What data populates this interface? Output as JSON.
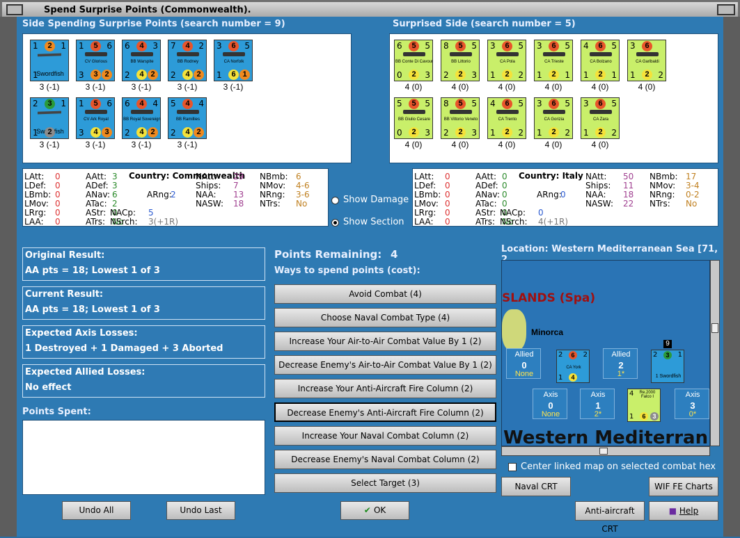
{
  "window": {
    "title": "Spend Surprise Points (Commonwealth)."
  },
  "left_panel": {
    "heading": "Side Spending Surprise Points (search number = 9)",
    "units": [
      {
        "tl": "1",
        "tm": "2",
        "tr": "1",
        "bl": "1",
        "bm": "",
        "br": "",
        "name": "Swordfish",
        "caption": "3 (-1)",
        "type": "air",
        "c1": "orange",
        "c2": "gray"
      },
      {
        "tl": "1",
        "tm": "5",
        "tr": "6",
        "bl": "3",
        "bm": "3",
        "br": "2",
        "name": "CV Glorious",
        "caption": "3 (-1)",
        "type": "ship",
        "c1": "red",
        "c2": "orange"
      },
      {
        "tl": "6",
        "tm": "4",
        "tr": "3",
        "bl": "2",
        "bm": "4",
        "br": "2",
        "name": "BB Warspite",
        "caption": "3 (-1)",
        "type": "ship",
        "c1": "red",
        "c2": "yellow"
      },
      {
        "tl": "7",
        "tm": "4",
        "tr": "2",
        "bl": "2",
        "bm": "4",
        "br": "2",
        "name": "BB Rodney",
        "caption": "3 (-1)",
        "type": "ship",
        "c1": "red",
        "c2": "yellow"
      },
      {
        "tl": "3",
        "tm": "6",
        "tr": "5",
        "bl": "1",
        "bm": "6",
        "br": "1",
        "name": "CA Norfolk",
        "caption": "3 (-1)",
        "type": "ship",
        "c1": "red",
        "c2": "yellow"
      },
      {
        "tl": "2",
        "tm": "3",
        "tr": "1",
        "bl": "1",
        "bm": "2",
        "br": "",
        "name": "Swordfish",
        "caption": "3 (-1)",
        "type": "air",
        "c1": "green",
        "c2": "gray"
      },
      {
        "tl": "1",
        "tm": "5",
        "tr": "6",
        "bl": "3",
        "bm": "4",
        "br": "3",
        "name": "CV Ark Royal",
        "caption": "3 (-1)",
        "type": "ship",
        "c1": "red",
        "c2": "yellow"
      },
      {
        "tl": "6",
        "tm": "4",
        "tr": "4",
        "bl": "2",
        "bm": "4",
        "br": "2",
        "name": "BB Royal Sovereign",
        "caption": "3 (-1)",
        "type": "ship",
        "c1": "red",
        "c2": "yellow"
      },
      {
        "tl": "5",
        "tm": "4",
        "tr": "4",
        "bl": "2",
        "bm": "4",
        "br": "2",
        "name": "BB Ramillies",
        "caption": "3 (-1)",
        "type": "ship",
        "c1": "red",
        "c2": "yellow"
      }
    ]
  },
  "right_panel": {
    "heading": "Surprised Side (search number = 5)",
    "units": [
      {
        "tl": "6",
        "tm": "5",
        "tr": "5",
        "bl": "0",
        "bm": "2",
        "br": "3",
        "name": "BB Conte Di Cavour",
        "caption": "4 (0)"
      },
      {
        "tl": "8",
        "tm": "5",
        "tr": "5",
        "bl": "2",
        "bm": "2",
        "br": "3",
        "name": "BB Littorio",
        "caption": "4 (0)"
      },
      {
        "tl": "3",
        "tm": "6",
        "tr": "5",
        "bl": "1",
        "bm": "2",
        "br": "2",
        "name": "CA Pola",
        "caption": "4 (0)"
      },
      {
        "tl": "3",
        "tm": "6",
        "tr": "5",
        "bl": "1",
        "bm": "2",
        "br": "1",
        "name": "CA Trieste",
        "caption": "4 (0)"
      },
      {
        "tl": "4",
        "tm": "6",
        "tr": "5",
        "bl": "1",
        "bm": "2",
        "br": "1",
        "name": "CA Bolzano",
        "caption": "4 (0)"
      },
      {
        "tl": "3",
        "tm": "6",
        "tr": "",
        "bl": "1",
        "bm": "2",
        "br": "2",
        "name": "CA Garibaldi",
        "caption": "4 (0)"
      },
      {
        "tl": "5",
        "tm": "5",
        "tr": "5",
        "bl": "0",
        "bm": "2",
        "br": "3",
        "name": "BB Giulio Cesare",
        "caption": "4 (0)"
      },
      {
        "tl": "8",
        "tm": "5",
        "tr": "5",
        "bl": "2",
        "bm": "2",
        "br": "3",
        "name": "BB Vittorio Veneto",
        "caption": "4 (0)"
      },
      {
        "tl": "4",
        "tm": "6",
        "tr": "5",
        "bl": "1",
        "bm": "2",
        "br": "2",
        "name": "CA Trento",
        "caption": "4 (0)"
      },
      {
        "tl": "3",
        "tm": "6",
        "tr": "5",
        "bl": "1",
        "bm": "2",
        "br": "2",
        "name": "CA Gorizia",
        "caption": "4 (0)"
      },
      {
        "tl": "3",
        "tm": "6",
        "tr": "5",
        "bl": "1",
        "bm": "2",
        "br": "2",
        "name": "CA Zara",
        "caption": "4 (0)"
      }
    ]
  },
  "stats_left": {
    "country": "Country: Commonwealth",
    "rows": [
      [
        "LAtt:",
        "0",
        "AAtt:",
        "3",
        "",
        "",
        "NAtt:",
        "29",
        "NBmb:",
        "6"
      ],
      [
        "LDef:",
        "0",
        "ADef:",
        "3",
        "",
        "",
        "Ships:",
        "7",
        "NMov:",
        "4-6"
      ],
      [
        "LBmb:",
        "0",
        "ANav:",
        "6",
        "ARng:",
        "2",
        "NAA:",
        "13",
        "NRng:",
        "3-6"
      ],
      [
        "LMov:",
        "0",
        "ATac:",
        "2",
        "",
        "",
        "NASW:",
        "18",
        "NTrs:",
        "No"
      ],
      [
        "LRrg:",
        "0",
        "AStr:",
        "0",
        "NACp:",
        "5",
        "",
        "",
        "",
        ""
      ],
      [
        "LAA:",
        "0",
        "ATrs:",
        "No",
        "NSrch:",
        "3(+1R)",
        "",
        "",
        "",
        ""
      ]
    ]
  },
  "stats_right": {
    "country": "Country: Italy",
    "rows": [
      [
        "LAtt:",
        "0",
        "AAtt:",
        "0",
        "",
        "",
        "NAtt:",
        "50",
        "NBmb:",
        "17"
      ],
      [
        "LDef:",
        "0",
        "ADef:",
        "0",
        "",
        "",
        "Ships:",
        "11",
        "NMov:",
        "3-4"
      ],
      [
        "LBmb:",
        "0",
        "ANav:",
        "0",
        "ARng:",
        "0",
        "NAA:",
        "18",
        "NRng:",
        "0-2"
      ],
      [
        "LMov:",
        "0",
        "ATac:",
        "0",
        "",
        "",
        "NASW:",
        "22",
        "NTrs:",
        "No"
      ],
      [
        "LRrg:",
        "0",
        "AStr:",
        "0",
        "NACp:",
        "0",
        "",
        "",
        "",
        ""
      ],
      [
        "LAA:",
        "0",
        "ATrs:",
        "No",
        "NSrch:",
        "4(+1R)",
        "",
        "",
        "",
        ""
      ]
    ]
  },
  "radios": {
    "show_damage": "Show Damage",
    "show_section": "Show Section"
  },
  "results": [
    {
      "title": "Original Result:",
      "value": "AA pts = 18; Lowest 1 of 3"
    },
    {
      "title": "Current Result:",
      "value": "AA pts = 18; Lowest 1 of 3"
    },
    {
      "title": "Expected Axis Losses:",
      "value": "1 Destroyed + 1 Damaged + 3 Aborted"
    },
    {
      "title": "Expected Allied Losses:",
      "value": "No effect"
    }
  ],
  "points_spent_label": "Points Spent:",
  "points_remaining": {
    "label": "Points Remaining:",
    "value": "4"
  },
  "ways_label": "Ways to spend points (cost):",
  "options": [
    "Avoid Combat (4)",
    "Choose Naval Combat Type (4)",
    "Increase Your Air-to-Air Combat Value By 1 (2)",
    "Decrease Enemy's Air-to-Air Combat Value By 1 (2)",
    "Increase Your Anti-Aircraft Fire Column (2)",
    "Decrease Enemy's Anti-Aircraft Fire Column (2)",
    "Increase Your Naval Combat Column (2)",
    "Decrease Enemy's Naval Combat Column (2)",
    "Select Target (3)"
  ],
  "location": "Location: Western Mediterranean Sea [71, 2",
  "map": {
    "region": "SLANDS (Spa)",
    "island": "Minorca",
    "sea": "Western Mediterran",
    "allied": [
      {
        "label": "Allied",
        "num": "0",
        "sub": "None"
      },
      {
        "label": "Allied",
        "num": "2",
        "sub": "1*"
      }
    ],
    "axis": [
      {
        "label": "Axis",
        "num": "0",
        "sub": "None"
      },
      {
        "label": "Axis",
        "num": "1",
        "sub": "2*"
      },
      {
        "label": "Axis",
        "num": "3",
        "sub": "0*"
      }
    ],
    "unit1": {
      "tl": "2",
      "tm": "6",
      "tr": "2",
      "bl": "1",
      "bm": "4",
      "name": "CA York"
    },
    "unit2": {
      "tl": "2",
      "tm": "3",
      "tr": "1",
      "name": "1 Swordfish",
      "badge": "9"
    },
    "unit3": {
      "tl": "4",
      "name": "Re.2000 Falco I",
      "bl": "1",
      "bm": "6",
      "br": "3"
    }
  },
  "center_checkbox": "Center linked map on selected combat hex",
  "buttons": {
    "undo_all": "Undo All",
    "undo_last": "Undo Last",
    "ok": "OK",
    "naval_crt": "Naval CRT",
    "fe_charts": "WIF FE Charts",
    "aa_crt": "Anti-aircraft CRT",
    "help": "Help"
  },
  "colors": {
    "red": "#e8552b",
    "orange": "#f08a1f",
    "yellow": "#f5e23a",
    "gray": "#8c8c8c",
    "green": "#2a9a3a"
  }
}
